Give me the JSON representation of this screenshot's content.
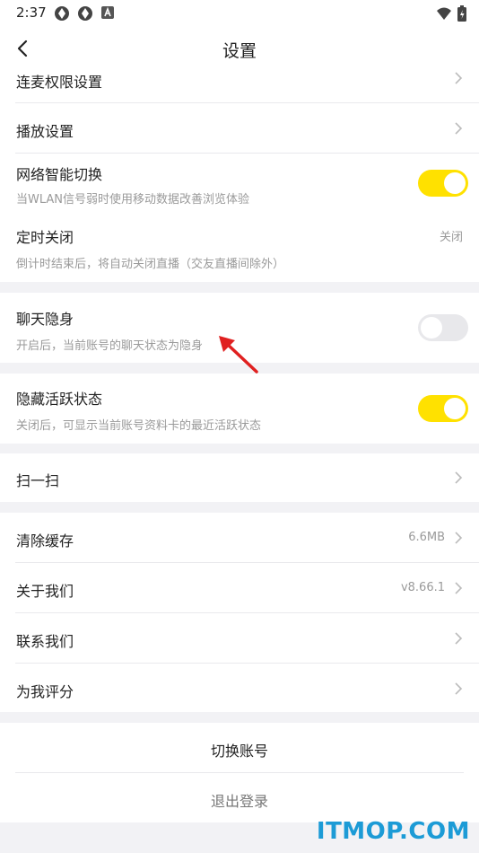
{
  "status_bar": {
    "time": "2:37"
  },
  "nav": {
    "title": "设置"
  },
  "rows": {
    "mic_permission": {
      "label": "连麦权限设置"
    },
    "playback": {
      "label": "播放设置"
    },
    "network_switch": {
      "label": "网络智能切换",
      "desc": "当WLAN信号弱时使用移动数据改善浏览体验",
      "on": true
    },
    "timer_off": {
      "label": "定时关闭",
      "desc": "倒计时结束后，将自动关闭直播（交友直播间除外）",
      "value": "关闭"
    },
    "chat_invisible": {
      "label": "聊天隐身",
      "desc": "开启后，当前账号的聊天状态为隐身",
      "on": false
    },
    "hide_active": {
      "label": "隐藏活跃状态",
      "desc": "关闭后，可显示当前账号资料卡的最近活跃状态",
      "on": true
    },
    "scan": {
      "label": "扫一扫"
    },
    "clear_cache": {
      "label": "清除缓存",
      "value": "6.6MB"
    },
    "about": {
      "label": "关于我们",
      "value": "v8.66.1"
    },
    "contact": {
      "label": "联系我们"
    },
    "rate": {
      "label": "为我评分"
    }
  },
  "account": {
    "switch_label": "切换账号",
    "logout_label": "退出登录"
  },
  "watermark": "ITMOP.COM",
  "colors": {
    "toggle_on": "#ffe100",
    "toggle_off": "#e8e8eb",
    "watermark": "#1c9bd6",
    "arrow": "#e02020"
  }
}
